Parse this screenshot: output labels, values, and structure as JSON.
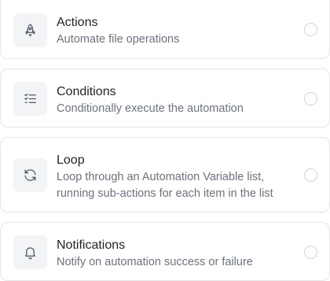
{
  "options": [
    {
      "icon": "rocket-icon",
      "title": "Actions",
      "description": "Automate file operations",
      "selected": false
    },
    {
      "icon": "checklist-icon",
      "title": "Conditions",
      "description": "Conditionally execute the automation",
      "selected": false
    },
    {
      "icon": "refresh-icon",
      "title": "Loop",
      "description": "Loop through an Automation Variable list, running sub-actions for each item in the list",
      "selected": false
    },
    {
      "icon": "bell-icon",
      "title": "Notifications",
      "description": "Notify on automation success or failure",
      "selected": false
    }
  ],
  "colors": {
    "icon_stroke": "#4b5563",
    "icon_bg": "#f3f4f6",
    "border": "#e4e6ea",
    "description": "#6b7280"
  }
}
